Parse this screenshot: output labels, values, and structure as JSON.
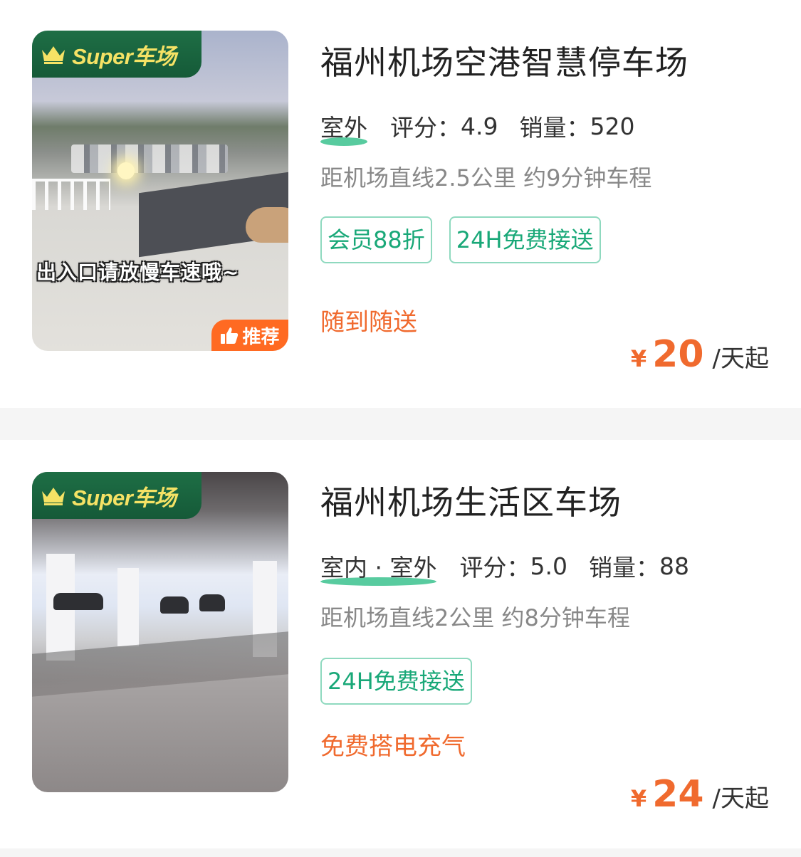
{
  "listings": [
    {
      "badge": "Super车场",
      "overlay_text": "出入口请放慢车速哦~",
      "recommend_label": "推荐",
      "title": "福州机场空港智慧停车场",
      "type": "室外",
      "rating_label": "评分：",
      "rating": "4.9",
      "sales_label": "销量：",
      "sales": "520",
      "distance": "距机场直线2.5公里 约9分钟车程",
      "tags": [
        "会员88折",
        "24H免费接送"
      ],
      "promo": "随到随送",
      "currency": "¥",
      "price": "20",
      "price_unit": "/天起"
    },
    {
      "badge": "Super车场",
      "title": "福州机场生活区车场",
      "type": "室内 · 室外",
      "rating_label": "评分：",
      "rating": "5.0",
      "sales_label": "销量：",
      "sales": "88",
      "distance": "距机场直线2公里 约8分钟车程",
      "tags": [
        "24H免费接送"
      ],
      "promo": "免费搭电充气",
      "currency": "¥",
      "price": "24",
      "price_unit": "/天起"
    }
  ],
  "colors": {
    "accent_orange": "#f06a2e",
    "tag_green": "#19a878",
    "badge_green": "#1e6e45",
    "badge_text": "#f5e265"
  },
  "icons": [
    "crown-icon",
    "thumbs-up-icon"
  ]
}
